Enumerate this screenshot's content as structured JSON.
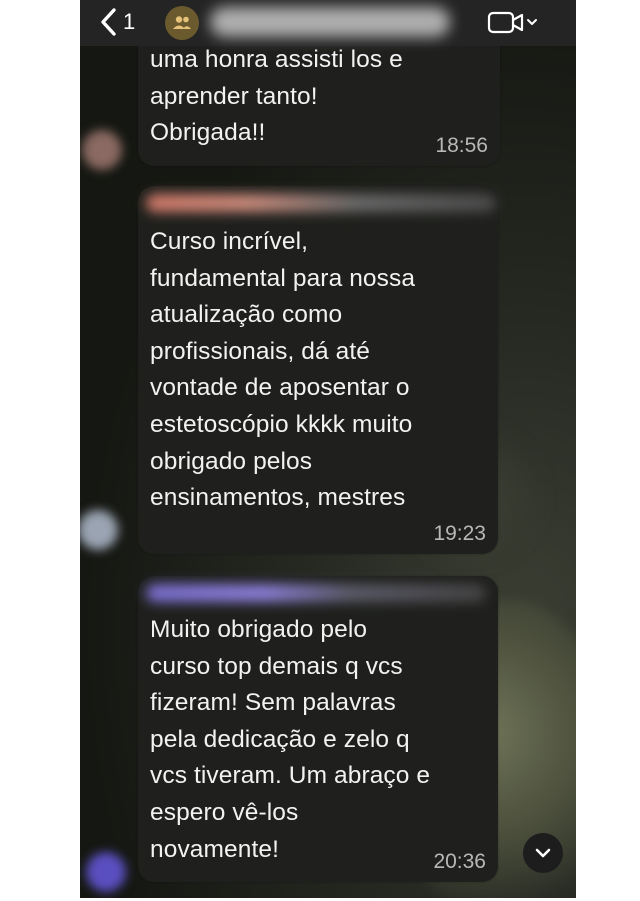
{
  "header": {
    "back_count": "1",
    "icons": {
      "back": "chevron-left-icon",
      "group": "group-icon",
      "video": "video-call-icon",
      "dropdown": "chevron-down-icon"
    }
  },
  "messages": [
    {
      "text": "uma honra assisti los e\naprender tanto!\nObrigada!!",
      "time": "18:56"
    },
    {
      "text": "Curso incrível,\nfundamental para nossa\natualização como\nprofissionais, dá até\nvontade de aposentar o\nestetoscópio kkkk muito\nobrigado pelos\nensinamentos, mestres",
      "time": "19:23"
    },
    {
      "text": "Muito obrigado pelo\ncurso top demais q vcs\nfizeram! Sem palavras\npela dedicação e zelo q\nvcs tiveram. Um abraço e\nespero vê-los\nnovamente!",
      "time": "20:36"
    }
  ],
  "colors": {
    "bubble": "#1f201d",
    "topbar": "#242424",
    "text": "#f2f2f2",
    "time": "#b8b8b8"
  },
  "scroll_button_icon": "chevron-down-icon"
}
